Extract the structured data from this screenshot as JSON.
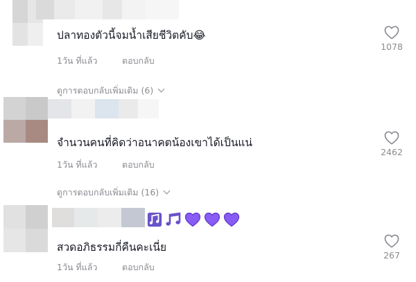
{
  "comments": [
    {
      "text": "ปลาทองตัวนี้จมน้ำเสียชีวิตคับ😂",
      "time": "1วัน ที่แล้ว",
      "reply_label": "ตอบกลับ",
      "likes": "1078",
      "view_replies": "ดูการตอบกลับเพิ่มเติม (6)"
    },
    {
      "text": "จำนวนคนที่คิดว่าอนาคตน้องเขาได้เป็นแน่",
      "time": "1วัน ที่แล้ว",
      "reply_label": "ตอบกลับ",
      "likes": "2462",
      "view_replies": "ดูการตอบกลับเพิ่มเติม (16)"
    },
    {
      "text": "สวดอภิธรรมกี่คืนคะเนี่ย",
      "time": "1วัน ที่แล้ว",
      "reply_label": "ตอบกลับ",
      "likes": "267"
    }
  ],
  "icons": {
    "like": "heart-outline-icon",
    "expand": "chevron-down-icon",
    "username_emojis": [
      "music-notes-icon",
      "music-note-icon",
      "purple-heart-icon",
      "purple-heart-icon",
      "purple-heart-icon"
    ]
  },
  "colors": {
    "text": "#161823",
    "secondary": "#8a8b91",
    "heart_outline": "#8a8b91",
    "purple_heart": "#8a5cf6"
  }
}
